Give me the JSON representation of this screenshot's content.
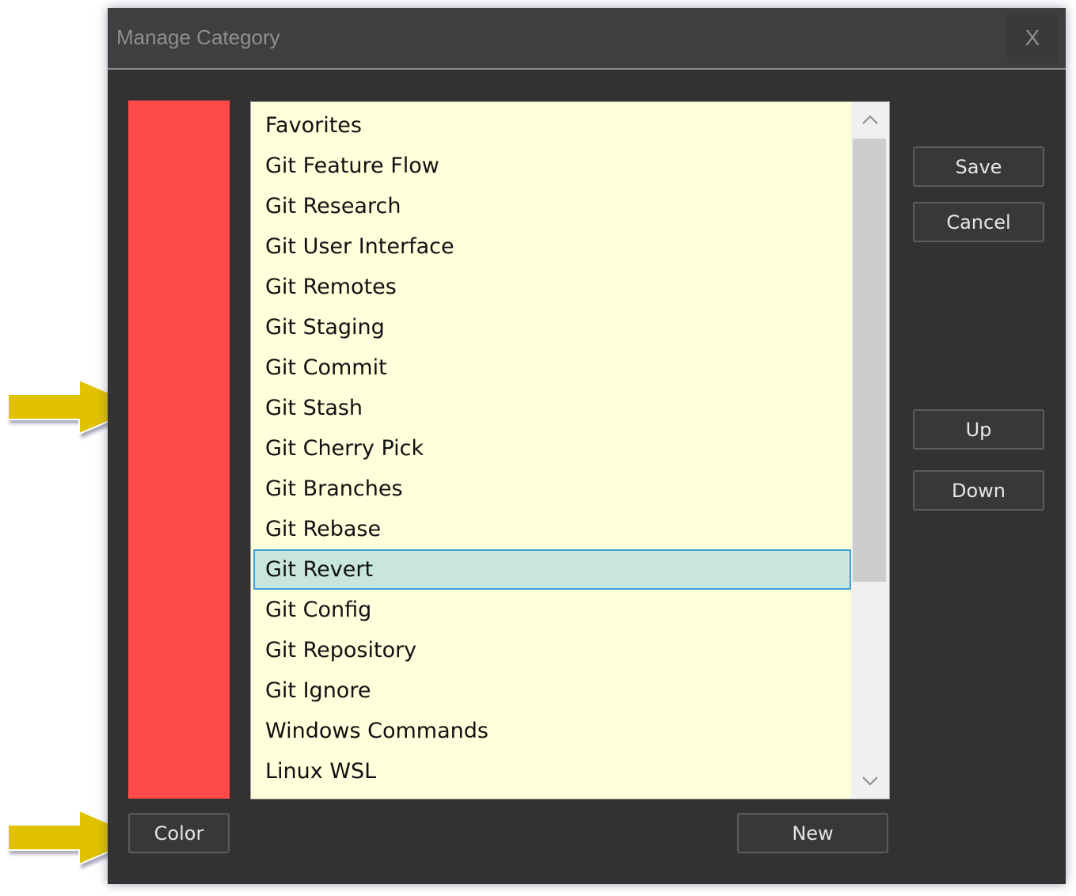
{
  "window": {
    "title": "Manage Category",
    "close_label": "X"
  },
  "color_swatch": {
    "color": "#ff4a4a"
  },
  "category_list": {
    "items": [
      "Favorites",
      "Git Feature Flow",
      "Git Research",
      "Git User Interface",
      "Git Remotes",
      "Git Staging",
      "Git Commit",
      "Git Stash",
      "Git Cherry Pick",
      "Git Branches",
      "Git Rebase",
      "Git Revert",
      "Git Config",
      "Git Repository",
      "Git Ignore",
      "Windows Commands",
      "Linux WSL"
    ],
    "selected_index": 11,
    "scroll_up_icon": "chevron-up-icon",
    "scroll_down_icon": "chevron-down-icon"
  },
  "buttons": {
    "save": "Save",
    "cancel": "Cancel",
    "up": "Up",
    "down": "Down",
    "color": "Color",
    "new": "New"
  },
  "annotations": {
    "arrow_color": "#e0c200",
    "arrows": [
      "pointer-arrow-icon",
      "pointer-arrow-icon"
    ]
  },
  "theme": {
    "dialog_bg": "#323232",
    "list_bg": "#ffffdc",
    "selection_bg": "#c8e6dc",
    "selection_border": "#3ea0d6"
  }
}
